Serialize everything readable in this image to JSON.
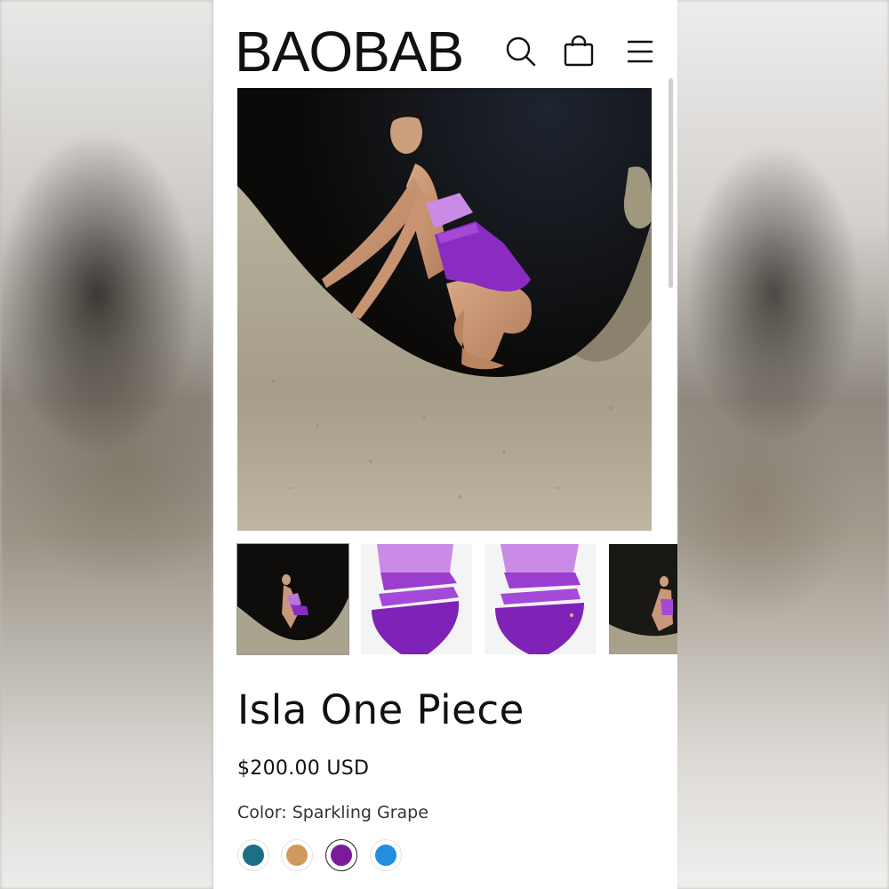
{
  "brand": {
    "logo_text": "BAOBAB"
  },
  "header": {
    "icons": [
      "search-icon",
      "shopping-bag-icon",
      "hamburger-menu-icon"
    ]
  },
  "gallery": {
    "thumbnails": [
      {
        "name": "model-crouching-on-rock",
        "active": true
      },
      {
        "name": "swimsuit-front-view",
        "active": false
      },
      {
        "name": "swimsuit-back-view",
        "active": false
      },
      {
        "name": "model-side-view",
        "active": false
      }
    ]
  },
  "product": {
    "title": "Isla One Piece",
    "price": "$200.00 USD",
    "color_label": "Color:",
    "color_value": "Sparkling Grape",
    "swatches": [
      {
        "color": "#1b6f86",
        "selected": false
      },
      {
        "color": "#d09a5e",
        "selected": false
      },
      {
        "color": "#7a1c98",
        "selected": true
      },
      {
        "color": "#1f8fde",
        "selected": false
      }
    ]
  },
  "colors": {
    "text": "#111111",
    "swimsuit_light": "#c98be6",
    "swimsuit_dark": "#8a2bc2"
  }
}
